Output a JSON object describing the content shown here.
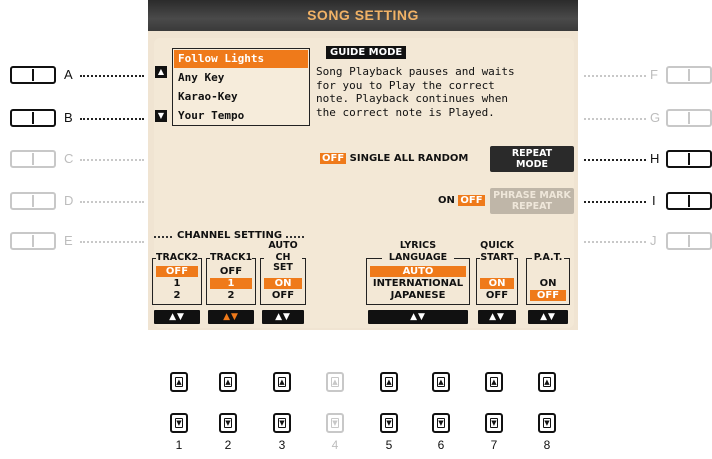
{
  "screen": {
    "title": "SONG SETTING"
  },
  "side_buttons": {
    "left": [
      {
        "label": "A",
        "active": true
      },
      {
        "label": "B",
        "active": true
      },
      {
        "label": "C",
        "active": false
      },
      {
        "label": "D",
        "active": false
      },
      {
        "label": "E",
        "active": false
      }
    ],
    "right": [
      {
        "label": "F",
        "active": false
      },
      {
        "label": "G",
        "active": false
      },
      {
        "label": "H",
        "active": true
      },
      {
        "label": "I",
        "active": true
      },
      {
        "label": "J",
        "active": false
      }
    ]
  },
  "guide_list": {
    "items": [
      "Follow Lights",
      "Any Key",
      "Karao-Key",
      "Your Tempo"
    ],
    "selected": "Follow Lights",
    "up_icon": "up-arrow-icon",
    "down_icon": "down-arrow-icon"
  },
  "guide_mode": {
    "title": "GUIDE MODE",
    "line1": "Song Playback pauses and waits",
    "line2": "for you to Play the correct",
    "line3": "note. Playback continues when",
    "line4": "the correct note is Played."
  },
  "repeat": {
    "off_label": "OFF",
    "options": "SINGLE ALL RANDOM",
    "button_line1": "REPEAT",
    "button_line2": "MODE"
  },
  "phrase": {
    "on_label": "ON",
    "off_label": "OFF",
    "button_line1": "PHRASE MARK",
    "button_line2": "REPEAT"
  },
  "channel_setting": {
    "title": "CHANNEL SETTING",
    "track2": {
      "header": "TRACK2",
      "values": [
        "OFF",
        "1",
        "2"
      ],
      "selected": "OFF"
    },
    "track1": {
      "header": "TRACK1",
      "values": [
        "OFF",
        "1",
        "2"
      ],
      "selected": "1"
    },
    "auto_ch": {
      "header1": "AUTO",
      "header2": "CH SET",
      "values": [
        "ON",
        "OFF"
      ],
      "selected": "ON"
    }
  },
  "lyrics": {
    "header1": "LYRICS",
    "header2": "LANGUAGE",
    "values": [
      "AUTO",
      "INTERNATIONAL",
      "JAPANESE"
    ],
    "selected": "AUTO"
  },
  "quick_start": {
    "header1": "QUICK",
    "header2": "START",
    "values": [
      "ON",
      "OFF"
    ],
    "selected": "ON"
  },
  "pat": {
    "header": "P.A.T.",
    "values": [
      "ON",
      "OFF"
    ],
    "selected": "OFF"
  },
  "bottom_buttons": {
    "numbers": [
      "1",
      "2",
      "3",
      "4",
      "5",
      "6",
      "7",
      "8"
    ],
    "disabled": "4"
  },
  "colors": {
    "accent": "#ef7a1a",
    "screen_bg": "#f0e4d2",
    "titlebar_text": "#f1b266"
  }
}
